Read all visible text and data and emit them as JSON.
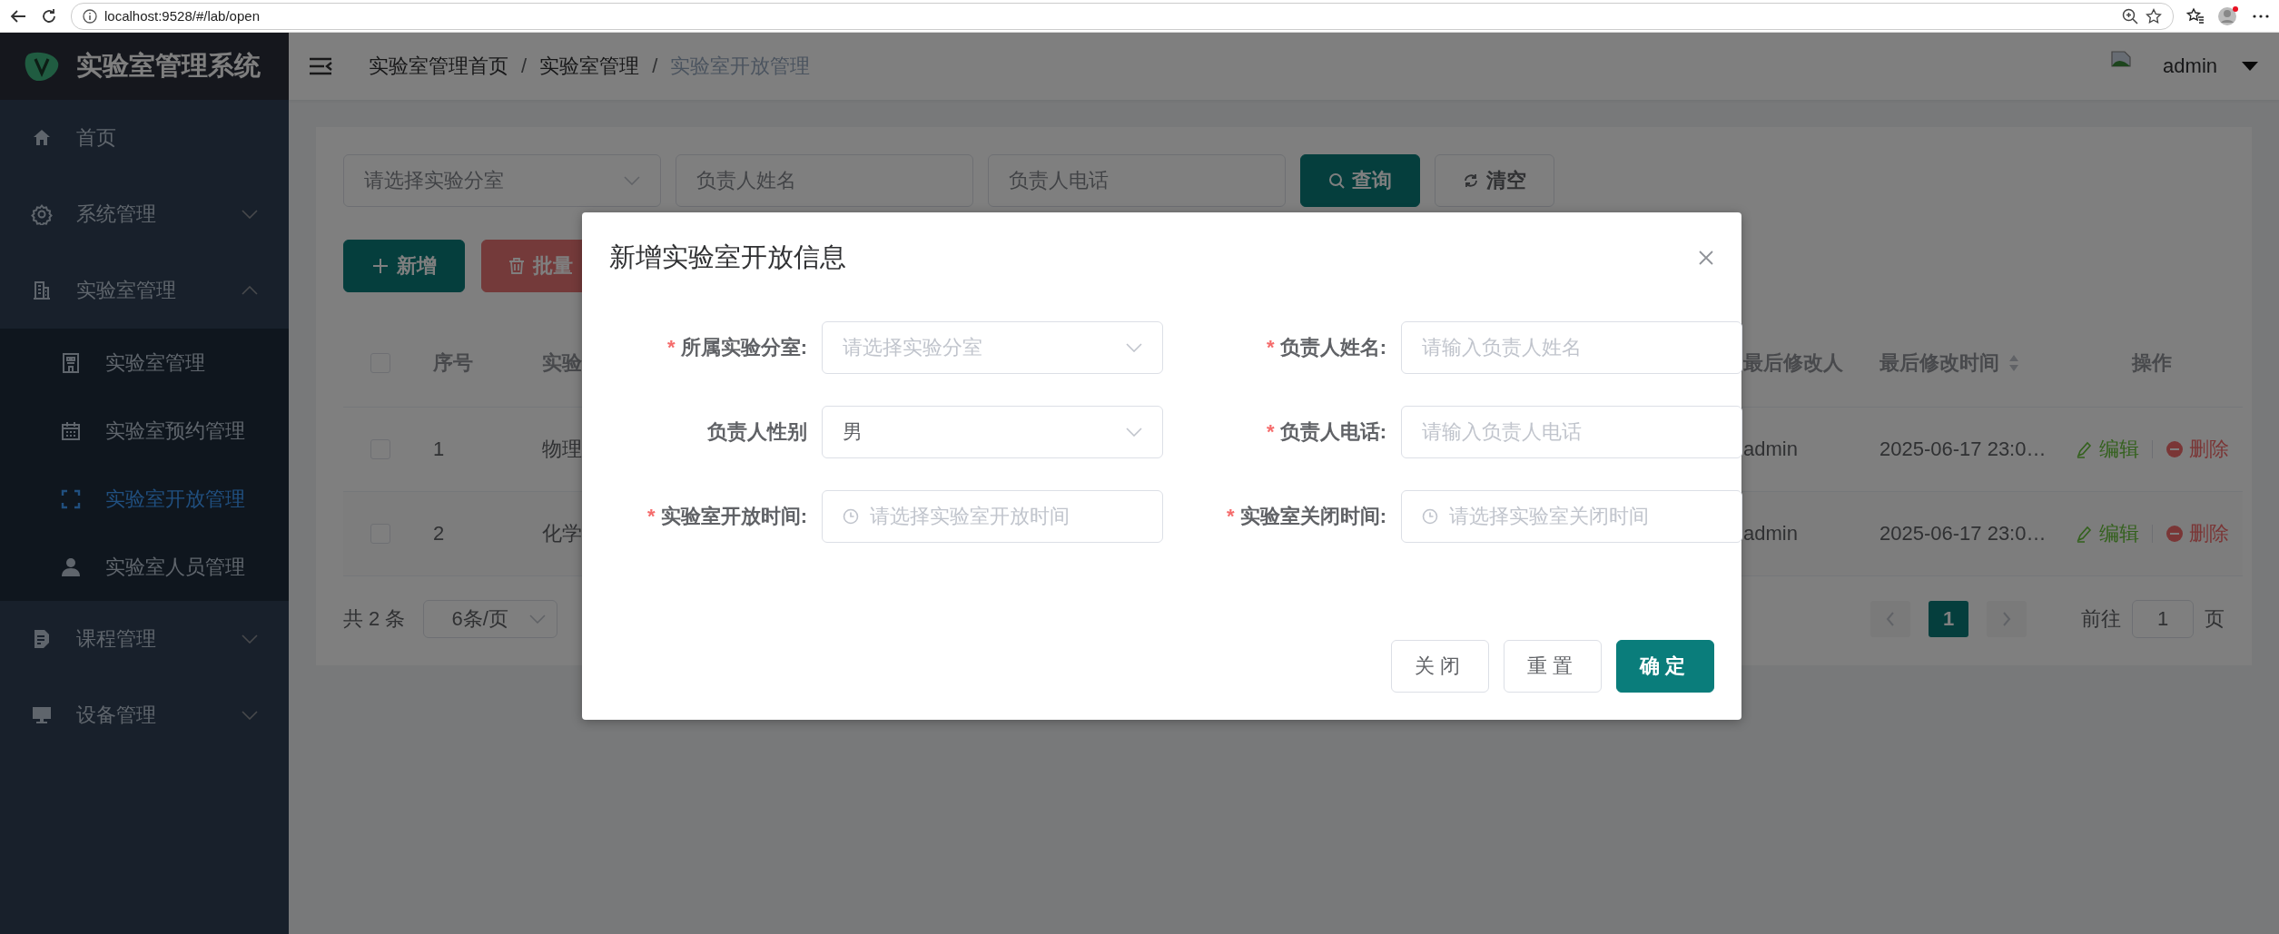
{
  "browser": {
    "url": "localhost:9528/#/lab/open"
  },
  "sidebar": {
    "title": "实验室管理系统",
    "items": [
      {
        "label": "首页",
        "kind": "link"
      },
      {
        "label": "系统管理",
        "kind": "submenu",
        "expanded": false
      },
      {
        "label": "实验室管理",
        "kind": "submenu",
        "expanded": true,
        "children": [
          {
            "label": "实验室管理",
            "selected": false
          },
          {
            "label": "实验室预约管理",
            "selected": false
          },
          {
            "label": "实验室开放管理",
            "selected": true
          },
          {
            "label": "实验室人员管理",
            "selected": false
          }
        ]
      },
      {
        "label": "课程管理",
        "kind": "submenu",
        "expanded": false
      },
      {
        "label": "设备管理",
        "kind": "submenu",
        "expanded": false
      }
    ]
  },
  "header": {
    "breadcrumb": [
      "实验室管理首页",
      "实验室管理",
      "实验室开放管理"
    ],
    "separator": "/",
    "user": "admin"
  },
  "search": {
    "fields": [
      {
        "kind": "select",
        "placeholder": "请选择实验分室"
      },
      {
        "kind": "input",
        "placeholder": "负责人姓名"
      },
      {
        "kind": "input",
        "placeholder": "负责人电话"
      }
    ],
    "buttons": [
      {
        "label": "查询",
        "kind": "primary"
      },
      {
        "label": "清空",
        "kind": "default"
      }
    ]
  },
  "toolbar": {
    "buttons": [
      {
        "label": "新增",
        "kind": "primary"
      },
      {
        "label": "批量",
        "kind": "danger"
      }
    ]
  },
  "table": {
    "header_checked": false,
    "columns": [
      {
        "label": "序号"
      },
      {
        "label": "实验"
      },
      {
        "label": "最后修改人"
      },
      {
        "label": "最后修改时间",
        "sortable": true
      },
      {
        "label": "操作"
      }
    ],
    "rows": [
      {
        "checked": false,
        "index": "1",
        "column_3": "物理",
        "modifier": "admin",
        "time": "2025-06-17 23:0…",
        "actions": [
          {
            "label": "编辑",
            "kind": "edit"
          },
          {
            "label": "删除",
            "kind": "delete"
          }
        ]
      },
      {
        "checked": false,
        "index": "2",
        "column_3": "化学",
        "modifier": "admin",
        "time": "2025-06-17 23:0…",
        "actions": [
          {
            "label": "编辑",
            "kind": "edit"
          },
          {
            "label": "删除",
            "kind": "delete"
          }
        ]
      }
    ]
  },
  "pagination": {
    "total": "共 2 条",
    "page_size": "6条/页",
    "pages": [
      {
        "label": "1",
        "selected": true
      }
    ],
    "goto_label": "前往",
    "goto_value": "1",
    "goto_suffix": "页"
  },
  "dialog": {
    "title": "新增实验室开放信息",
    "required_mark": "*",
    "fields": [
      {
        "label": "所属实验分室:",
        "required": true,
        "kind": "select",
        "placeholder": "请选择实验分室"
      },
      {
        "label": "负责人姓名:",
        "required": true,
        "kind": "input",
        "placeholder": "请输入负责人姓名"
      },
      {
        "label": "负责人性别",
        "required": false,
        "kind": "select",
        "value": "男"
      },
      {
        "label": "负责人电话:",
        "required": true,
        "kind": "input",
        "placeholder": "请输入负责人电话"
      },
      {
        "label": "实验室开放时间:",
        "required": true,
        "kind": "time",
        "placeholder": "请选择实验室开放时间"
      },
      {
        "label": "实验室关闭时间:",
        "required": true,
        "kind": "time",
        "placeholder": "请选择实验室关闭时间"
      }
    ],
    "buttons": [
      {
        "label": "关闭",
        "kind": "default"
      },
      {
        "label": "重置",
        "kind": "default"
      },
      {
        "label": "确定",
        "kind": "primary"
      }
    ]
  }
}
